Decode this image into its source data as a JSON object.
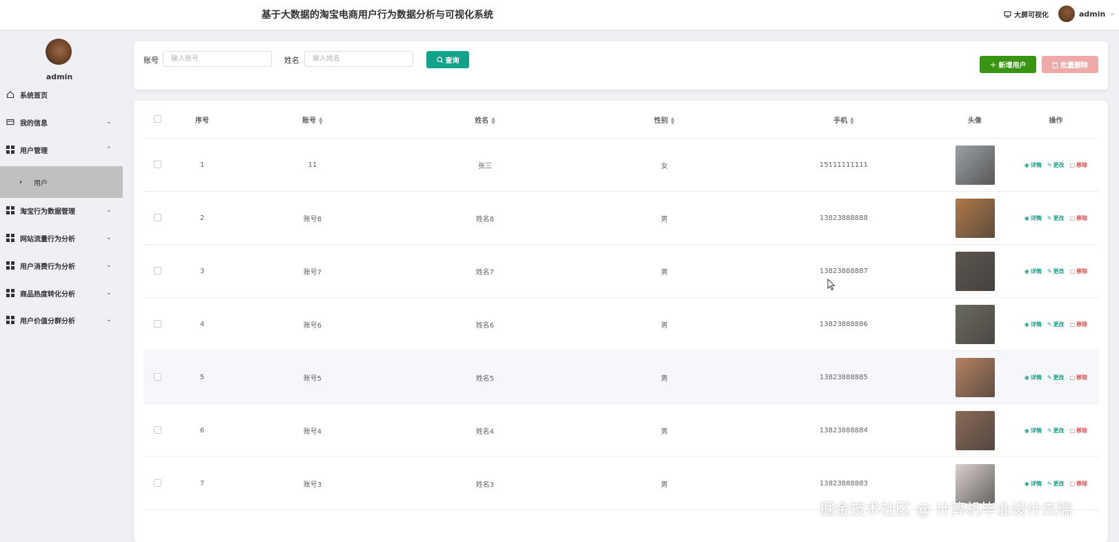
{
  "header": {
    "title": "基于大数据的淘宝电商用户行为数据分析与可视化系统",
    "screen_link": "大屏可视化",
    "username": "admin"
  },
  "sidebar": {
    "username": "admin",
    "items": [
      {
        "label": "系统首页"
      },
      {
        "label": "我的信息"
      },
      {
        "label": "用户管理"
      },
      {
        "label": "用户"
      },
      {
        "label": "淘宝行为数据管理"
      },
      {
        "label": "网站流量行为分析"
      },
      {
        "label": "用户消费行为分析"
      },
      {
        "label": "商品热度转化分析"
      },
      {
        "label": "用户价值分群分析"
      }
    ]
  },
  "search": {
    "account_label": "账号",
    "account_placeholder": "输入账号",
    "name_label": "姓名",
    "name_placeholder": "输入姓名",
    "search_button": "查询",
    "add_button": "新增用户",
    "batch_delete_button": "批量删除"
  },
  "table": {
    "headers": {
      "index": "序号",
      "account": "账号",
      "name": "姓名",
      "gender": "性别",
      "phone": "手机",
      "avatar": "头像",
      "ops": "操作"
    },
    "actions": {
      "view": "详情",
      "edit": "更改",
      "remove": "移除"
    },
    "rows": [
      {
        "index": "1",
        "account": "11",
        "name": "张三",
        "gender": "女",
        "phone": "15111111111",
        "avatar_color": "#9aa0a6"
      },
      {
        "index": "2",
        "account": "账号8",
        "name": "姓名8",
        "gender": "男",
        "phone": "13823888888",
        "avatar_color": "#b07848"
      },
      {
        "index": "3",
        "account": "账号7",
        "name": "姓名7",
        "gender": "男",
        "phone": "13823888887",
        "avatar_color": "#5c5550"
      },
      {
        "index": "4",
        "account": "账号6",
        "name": "姓名6",
        "gender": "男",
        "phone": "13823888886",
        "avatar_color": "#6b6a60"
      },
      {
        "index": "5",
        "account": "账号5",
        "name": "姓名5",
        "gender": "男",
        "phone": "13823888885",
        "avatar_color": "#b58060"
      },
      {
        "index": "6",
        "account": "账号4",
        "name": "姓名4",
        "gender": "男",
        "phone": "13823888884",
        "avatar_color": "#8a6a58"
      },
      {
        "index": "7",
        "account": "账号3",
        "name": "姓名3",
        "gender": "男",
        "phone": "13823888883",
        "avatar_color": "#d8d0cc"
      }
    ]
  },
  "watermark": "掘金技术社区 @ 计算机毕业设计杰瑞"
}
